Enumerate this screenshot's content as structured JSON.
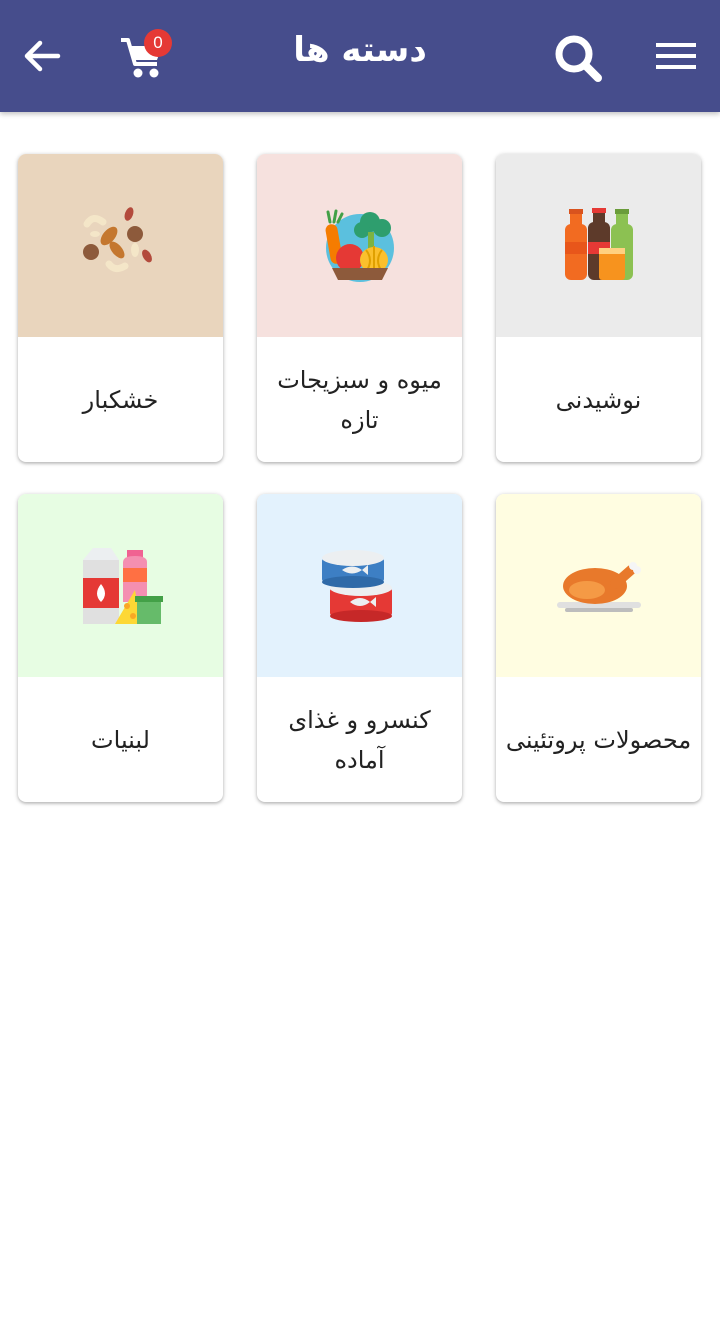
{
  "header": {
    "title": "دسته ها",
    "cart_count": "0",
    "background_color": "#464d8c"
  },
  "categories": [
    {
      "label": "نوشیدنی",
      "image_bg": "#ebebeb",
      "icon": "soda-bottles-icon"
    },
    {
      "label": "میوه و سبزیجات تازه",
      "image_bg": "#f6e1de",
      "icon": "vegetable-basket-icon"
    },
    {
      "label": "خشکبار",
      "image_bg": "#e9d5bd",
      "icon": "nuts-icon"
    },
    {
      "label": "محصولات پروتئینی",
      "image_bg": "#fffde1",
      "icon": "roast-chicken-icon"
    },
    {
      "label": "کنسرو و غذای آماده",
      "image_bg": "#e3f2fd",
      "icon": "canned-fish-icon"
    },
    {
      "label": "لبنیات",
      "image_bg": "#e7fde3",
      "icon": "dairy-products-icon"
    }
  ]
}
